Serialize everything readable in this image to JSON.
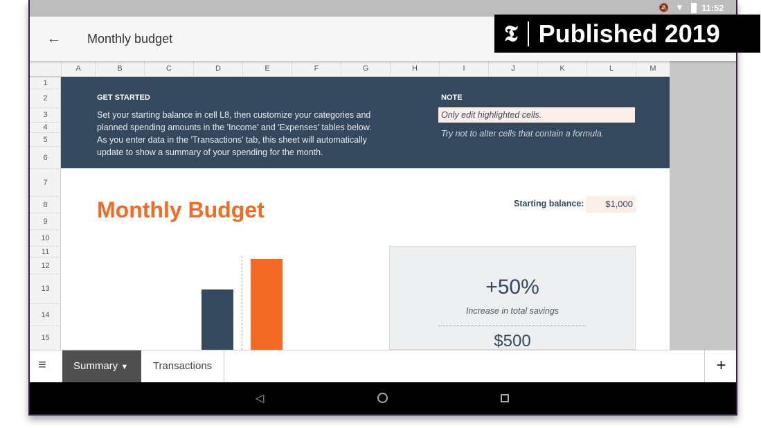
{
  "status_bar": {
    "time": "11:52",
    "icons": [
      "notifications-off-icon",
      "wifi-icon",
      "battery-icon"
    ]
  },
  "app_bar": {
    "title": "Monthly budget",
    "back_icon": "arrow-left-icon"
  },
  "columns": [
    "A",
    "B",
    "C",
    "D",
    "E",
    "F",
    "G",
    "H",
    "I",
    "J",
    "K",
    "L",
    "M"
  ],
  "rows": [
    "1",
    "2",
    "3",
    "4",
    "5",
    "6",
    "7",
    "8",
    "9",
    "10",
    "11",
    "12",
    "13",
    "14",
    "15"
  ],
  "banner": {
    "get_started_heading": "GET STARTED",
    "get_started_lines": [
      "Set your starting balance in cell L8, then customize your categories and",
      "planned spending amounts in the 'Income' and 'Expenses' tables below.",
      "As you enter data in the 'Transactions' tab, this sheet will automatically",
      "update to show a summary of your spending for the month."
    ],
    "note_heading": "NOTE",
    "note_highlight": "Only edit highlighted cells.",
    "note_text": "Try not to alter cells that contain a formula."
  },
  "summary": {
    "title": "Monthly Budget",
    "starting_balance_label": "Starting balance:",
    "starting_balance_value": "$1,000",
    "stat_value": "+50%",
    "stat_label": "Increase in total savings",
    "stat2_value": "$500"
  },
  "chart_data": {
    "type": "bar",
    "categories": [
      "",
      ""
    ],
    "values": [
      1000,
      1500
    ],
    "colors": [
      "#34495e",
      "#f26a24"
    ]
  },
  "sheet_tabs": {
    "menu_icon": "list-icon",
    "tabs": [
      {
        "label": "Summary",
        "active": true
      },
      {
        "label": "Transactions",
        "active": false
      }
    ],
    "add_icon": "plus-icon"
  },
  "nav_bar": {
    "icons": [
      "back-triangle-icon",
      "home-circle-icon",
      "recents-square-icon"
    ]
  },
  "badge": {
    "text": "Published 2019",
    "logo": "T"
  },
  "colors": {
    "banner": "#34495e",
    "accent": "#f26a24",
    "highlight": "#fdeee8"
  }
}
